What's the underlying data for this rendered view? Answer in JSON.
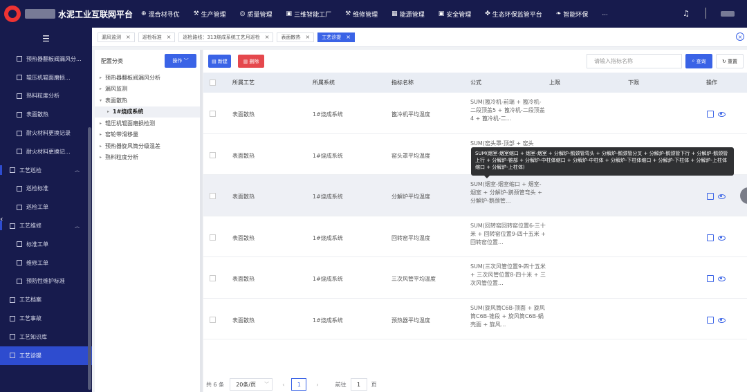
{
  "header": {
    "title": "水泥工业互联网平台",
    "nav": [
      {
        "icon": "compass-icon",
        "glyph": "⊕",
        "label": "混合材寻优"
      },
      {
        "icon": "production-icon",
        "glyph": "⚒",
        "label": "生产管理"
      },
      {
        "icon": "quality-icon",
        "glyph": "◎",
        "label": "质量管理"
      },
      {
        "icon": "factory-icon",
        "glyph": "▣",
        "label": "三维智能工厂"
      },
      {
        "icon": "maintenance-icon",
        "glyph": "⚒",
        "label": "维修管理"
      },
      {
        "icon": "energy-icon",
        "glyph": "▦",
        "label": "能源管理"
      },
      {
        "icon": "safety-icon",
        "glyph": "▣",
        "label": "安全管理"
      },
      {
        "icon": "eco-icon",
        "glyph": "✤",
        "label": "生态环保监管平台"
      },
      {
        "icon": "smart-eco-icon",
        "glyph": "❧",
        "label": "智能环保"
      },
      {
        "icon": "more-icon",
        "glyph": "",
        "label": "..."
      }
    ]
  },
  "sidebar": {
    "items": [
      {
        "label": "预热器翻板阀漏风分...",
        "kind": "sub"
      },
      {
        "label": "辊压机辊面磨损...",
        "kind": "sub"
      },
      {
        "label": "熟料粒度分析",
        "kind": "sub"
      },
      {
        "label": "表面散热",
        "kind": "sub"
      },
      {
        "label": "耐火材料更换记录",
        "kind": "sub"
      },
      {
        "label": "耐火材料更换记...",
        "kind": "sub"
      },
      {
        "label": "工艺巡检",
        "kind": "group"
      },
      {
        "label": "巡检标准",
        "kind": "sub"
      },
      {
        "label": "巡检工单",
        "kind": "sub"
      },
      {
        "label": "工艺维修",
        "kind": "group"
      },
      {
        "label": "标准工单",
        "kind": "sub"
      },
      {
        "label": "维修工单",
        "kind": "sub"
      },
      {
        "label": "预防性维护标准",
        "kind": "sub"
      },
      {
        "label": "工艺档案",
        "kind": "top"
      },
      {
        "label": "工艺事故",
        "kind": "top"
      },
      {
        "label": "工艺知识库",
        "kind": "top"
      },
      {
        "label": "工艺诊提",
        "kind": "top-active"
      }
    ]
  },
  "tabs": [
    {
      "label": "漏风监测",
      "active": false
    },
    {
      "label": "巡检标准",
      "active": false
    },
    {
      "label": "巡检路线：313烧成系统工艺月巡检",
      "active": false
    },
    {
      "label": "表面散热",
      "active": false
    },
    {
      "label": "工艺诊提",
      "active": true
    }
  ],
  "left_panel": {
    "title": "配置分类",
    "op_button": "操作",
    "tree": [
      {
        "label": "预热器翻板阀漏风分析",
        "level": 1,
        "arrow": "▸"
      },
      {
        "label": "漏风监测",
        "level": 1,
        "arrow": "▸"
      },
      {
        "label": "表面散热",
        "level": 1,
        "arrow": "▾"
      },
      {
        "label": "1#烧成系统",
        "level": 2,
        "arrow": "▸",
        "selected": true
      },
      {
        "label": "辊压机辊面磨损检测",
        "level": 1,
        "arrow": "▸"
      },
      {
        "label": "窑轮带滑移量",
        "level": 1,
        "arrow": "▸"
      },
      {
        "label": "预热器旋风筒分级温差",
        "level": 1,
        "arrow": "▸"
      },
      {
        "label": "熟料粒度分析",
        "level": 1,
        "arrow": "▸"
      }
    ]
  },
  "toolbar": {
    "new_label": "新建",
    "delete_label": "删除",
    "search_placeholder": "请输入指标名称",
    "search_label": "查询",
    "reset_label": "重置"
  },
  "table": {
    "columns": [
      "所属工艺",
      "所属系统",
      "指标名称",
      "公式",
      "上限",
      "下限",
      "操作"
    ],
    "rows": [
      {
        "process": "表面散热",
        "system": "1#烧成系统",
        "name": "篦冷机平均温度",
        "formula": "SUM(篦冷机-前端 + 篦冷机-二段顶盖5 + 篦冷机-二段顶盖4 + 篦冷机-二...",
        "upper": "",
        "lower": ""
      },
      {
        "process": "表面散热",
        "system": "1#烧成系统",
        "name": "窑头罩平均温度",
        "formula": "SUM(窑头罩-顶部 + 窑头",
        "upper": "",
        "lower": ""
      },
      {
        "process": "表面散热",
        "system": "1#烧成系统",
        "name": "分解炉平均温度",
        "formula": "SUM(烟室-烟室缩口 + 烟室-烟室 + 分解炉-鹅颈管弯头 + 分解炉-鹅颈管...",
        "upper": "",
        "lower": ""
      },
      {
        "process": "表面散热",
        "system": "1#烧成系统",
        "name": "回转窑平均温度",
        "formula": "SUM(回转窑回转窑位置6-三十米 + 回转窑位置9-四十五米 + 回转窑位置...",
        "upper": "",
        "lower": ""
      },
      {
        "process": "表面散热",
        "system": "1#烧成系统",
        "name": "三次风管平均温度",
        "formula": "SUM(三次风管位置9-四十五米 + 三次风管位置8-四十米 + 三次风管位置...",
        "upper": "",
        "lower": ""
      },
      {
        "process": "表面散热",
        "system": "1#烧成系统",
        "name": "预热器平均温度",
        "formula": "SUM(旋风筒C6B-顶面 + 旋风筒C6B-锥段 + 旋风筒C6B-蜗壳面 + 旋风...",
        "upper": "",
        "lower": ""
      }
    ]
  },
  "tooltip": "SUM(烟室-烟室缩口 + 烟室-烟室 + 分解炉-鹅颈管弯头 + 分解炉-鹅颈管分叉 + 分解炉-鹅颈管下行 + 分解炉-鹅颈管上行 + 分解炉-锥部 + 分解炉-中柱体缩口 + 分解炉-中柱体 + 分解炉-下柱体缩口 + 分解炉-下柱体 + 分解炉-上柱体缩口 + 分解炉-上柱体)",
  "pagination": {
    "total": "共 6 条",
    "page_size": "20条/页",
    "current": "1",
    "goto_label": "前往",
    "goto_value": "1",
    "page_unit": "页"
  }
}
